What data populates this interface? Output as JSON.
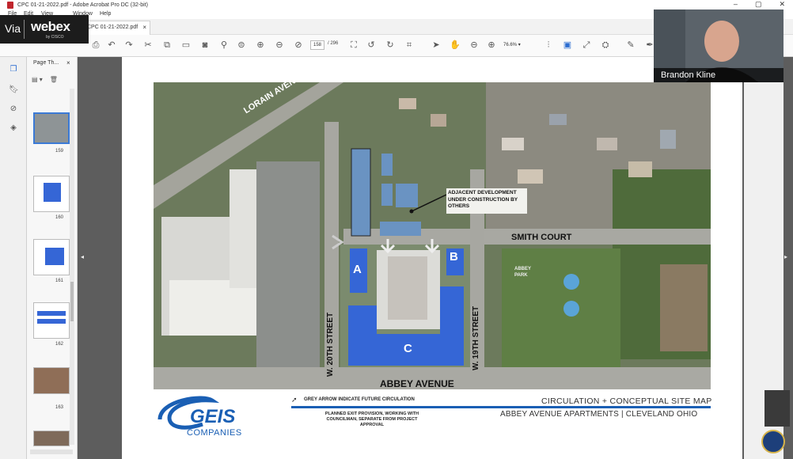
{
  "window": {
    "title": "CPC 01-21-2022.pdf - Adobe Acrobat Pro DC (32-bit)",
    "controls": [
      "–",
      "▢",
      "✕"
    ]
  },
  "menu": {
    "items": [
      "File",
      "Edit",
      "View",
      "Window",
      "Help"
    ]
  },
  "tab": {
    "label": "CPC 01-21-2022.pdf",
    "close": "×"
  },
  "toolbar": {
    "page_current": "158",
    "page_total": "/ 296",
    "zoom": "76.6%"
  },
  "webex": {
    "via": "Via",
    "brand": "webex",
    "sub": "by CISCO"
  },
  "thumbnails": {
    "panel_title": "Page Th...",
    "close": "×",
    "pages": [
      {
        "num": "159",
        "selected": true
      },
      {
        "num": "160",
        "selected": false
      },
      {
        "num": "161",
        "selected": false
      },
      {
        "num": "162",
        "selected": false
      },
      {
        "num": "163",
        "selected": false
      },
      {
        "num": "",
        "selected": false
      }
    ]
  },
  "video": {
    "participant_name": "Brandon Kline"
  },
  "sheet": {
    "streets": {
      "lorain": "LORAIN AVENUE",
      "smith": "SMITH COURT",
      "w20": "W. 20TH STREET",
      "w19": "W. 19TH STREET",
      "abbey": "ABBEY AVENUE"
    },
    "park_label": "ABBEY PARK",
    "adjacent_note": "ADJACENT DEVELOPMENT UNDER CONSTRUCTION BY OTHERS",
    "buildings": {
      "a": "A",
      "b": "B",
      "c": "C"
    },
    "legend_arrow_note": "GREY ARROW INDICATE FUTURE CIRCULATION",
    "legend_exit_note": "PLANNED EXIT PROVISION, WORKING WITH COUNCILMAN, SEPARATE FROM PROJECT APPROVAL",
    "logo_text": "GEIS",
    "logo_sub": "COMPANIES",
    "title": "CIRCULATION + CONCEPTUAL SITE MAP",
    "subtitle": "ABBEY AVENUE APARTMENTS | CLEVELAND OHIO"
  },
  "colors": {
    "building_blue": "#3566d6",
    "accent_blue": "#1a5fb4"
  }
}
